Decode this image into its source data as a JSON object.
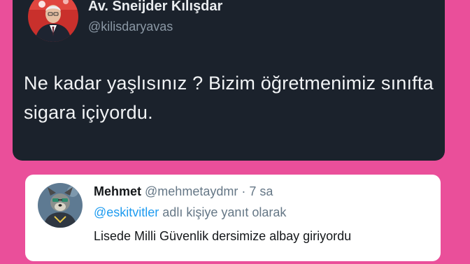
{
  "colors": {
    "background": "#ea4f9a",
    "dark_card": "#1b222c",
    "light_card": "#ffffff",
    "mention": "#1d9bf0",
    "muted_text": "#657786"
  },
  "original_tweet": {
    "display_name": "Av. Sneijder Kılışdar",
    "handle": "@kilisdaryavas",
    "text": "Ne kadar yaşlısınız ? Bizim öğretmenimiz sınıfta sigara içiyordu.",
    "avatar_icon": "profile-photo"
  },
  "reply_tweet": {
    "display_name": "Mehmet",
    "handle": "@mehmetaydmr",
    "separator": " · ",
    "time": "7 sa",
    "reply_to_handle": "@eskitvitler",
    "reply_to_suffix": " adlı kişiye yanıt olarak",
    "text": "Lisede Milli Güvenlik dersimize albay giriyordu",
    "avatar_icon": "cartoon-dog-avatar"
  }
}
